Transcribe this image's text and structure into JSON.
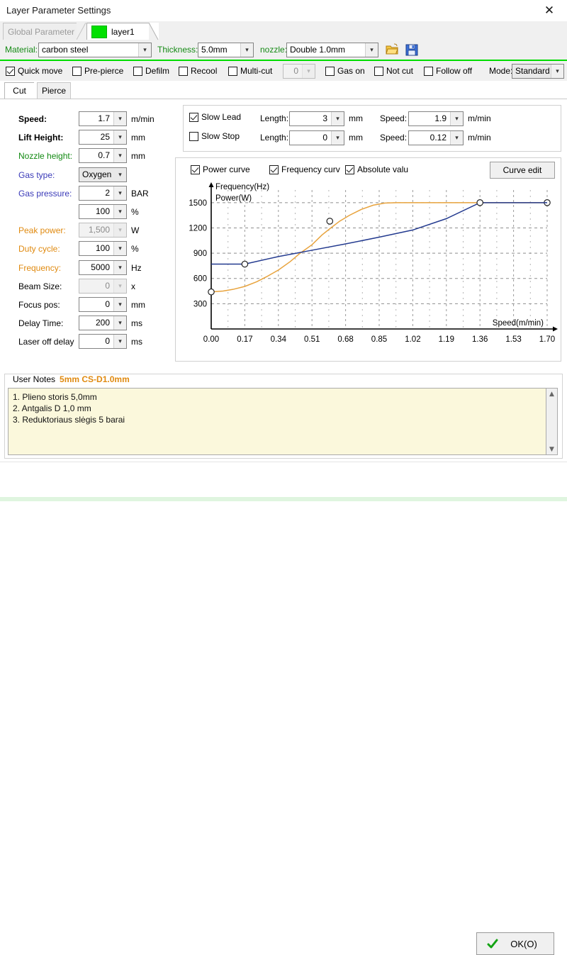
{
  "window": {
    "title": "Layer Parameter Settings",
    "close_label": "✕"
  },
  "tabs": [
    {
      "label": "Global Parameter",
      "active": false
    },
    {
      "label": "layer1",
      "active": true,
      "swatch_color": "#00e000"
    }
  ],
  "material_bar": {
    "material_label": "Material:",
    "material_value": "carbon steel",
    "thickness_label": "Thickness:",
    "thickness_value": "5.0mm",
    "nozzle_label": "nozzle:",
    "nozzle_value": "Double 1.0mm",
    "open_icon": "folder-open-icon",
    "save_icon": "save-disk-icon"
  },
  "option_row": {
    "quick_move": {
      "label": "Quick move",
      "checked": true
    },
    "pre_pierce": {
      "label": "Pre-pierce",
      "checked": false
    },
    "defilm": {
      "label": "Defilm",
      "checked": false
    },
    "recool": {
      "label": "Recool",
      "checked": false
    },
    "multi_cut": {
      "label": "Multi-cut",
      "checked": false
    },
    "multi_cut_count": "0",
    "gas_on": {
      "label": "Gas on",
      "checked": false
    },
    "not_cut": {
      "label": "Not cut",
      "checked": false
    },
    "follow_off": {
      "label": "Follow off",
      "checked": false
    },
    "mode_label": "Mode:",
    "mode_value": "Standard"
  },
  "sub_tabs": [
    {
      "label": "Cut",
      "active": true
    },
    {
      "label": "Pierce",
      "active": false
    }
  ],
  "parameters": [
    {
      "label": "Speed:",
      "value": "1.7",
      "unit": "m/min",
      "color": "#000000",
      "bold": true,
      "disabled": false
    },
    {
      "label": "Lift Height:",
      "value": "25",
      "unit": "mm",
      "color": "#000000",
      "bold": true,
      "disabled": false
    },
    {
      "label": "Nozzle height:",
      "value": "0.7",
      "unit": "mm",
      "color": "#128a12",
      "bold": false,
      "disabled": false
    },
    {
      "label": "Gas type:",
      "value": "Oxygen",
      "unit": "",
      "color": "#3a3ab8",
      "bold": false,
      "disabled": false,
      "combo": true
    },
    {
      "label": "Gas pressure:",
      "value": "2",
      "unit": "BAR",
      "color": "#3a3ab8",
      "bold": false,
      "disabled": false
    },
    {
      "label": "",
      "value": "100",
      "unit": "%",
      "color": "#000000",
      "bold": false,
      "disabled": false
    },
    {
      "label": "Peak power:",
      "value": "1,500",
      "unit": "W",
      "color": "#e08a10",
      "bold": false,
      "disabled": true
    },
    {
      "label": "Duty cycle:",
      "value": "100",
      "unit": "%",
      "color": "#e08a10",
      "bold": false,
      "disabled": false
    },
    {
      "label": "Frequency:",
      "value": "5000",
      "unit": "Hz",
      "color": "#e08a10",
      "bold": false,
      "disabled": false
    },
    {
      "label": "Beam Size:",
      "value": "0",
      "unit": "x",
      "color": "#000000",
      "bold": false,
      "disabled": true
    },
    {
      "label": "Focus pos:",
      "value": "0",
      "unit": "mm",
      "color": "#000000",
      "bold": false,
      "disabled": false
    },
    {
      "label": "Delay Time:",
      "value": "200",
      "unit": "ms",
      "color": "#000000",
      "bold": false,
      "disabled": false
    },
    {
      "label": "Laser off delay",
      "value": "0",
      "unit": "ms",
      "color": "#000000",
      "bold": false,
      "disabled": false
    }
  ],
  "slow_section": {
    "slow_lead": {
      "label": "Slow Lead",
      "checked": true
    },
    "slow_stop": {
      "label": "Slow Stop",
      "checked": false
    },
    "length_label": "Length:",
    "speed_label": "Speed:",
    "lead_length": "3",
    "lead_length_unit": "mm",
    "lead_speed": "1.9",
    "lead_speed_unit": "m/min",
    "stop_length": "0",
    "stop_length_unit": "mm",
    "stop_speed": "0.12",
    "stop_speed_unit": "m/min"
  },
  "curve_section": {
    "power_curve": {
      "label": "Power curve",
      "checked": true
    },
    "frequency_curve": {
      "label": "Frequency curv",
      "checked": true
    },
    "absolute_value": {
      "label": "Absolute valu",
      "checked": true
    },
    "curve_edit_label": "Curve edit"
  },
  "chart_data": {
    "type": "line",
    "title": "",
    "ylabel_top": "Frequency(Hz)",
    "ylabel_bottom": "Power(W)",
    "xlabel": "Speed(m/min)",
    "xlim": [
      0.0,
      1.7
    ],
    "ylim": [
      0,
      1650
    ],
    "xticks": [
      "0.00",
      "0.17",
      "0.34",
      "0.51",
      "0.68",
      "0.85",
      "1.02",
      "1.19",
      "1.36",
      "1.53",
      "1.70"
    ],
    "xtick_values": [
      0.0,
      0.17,
      0.34,
      0.51,
      0.68,
      0.85,
      1.02,
      1.19,
      1.36,
      1.53,
      1.7
    ],
    "yticks": [
      "300",
      "600",
      "900",
      "1200",
      "1500"
    ],
    "ytick_values": [
      300,
      600,
      900,
      1200,
      1500
    ],
    "grid": true,
    "legend": "none",
    "series": [
      {
        "name": "Frequency",
        "color": "#e8a33d",
        "markers": [
          [
            0.0,
            440
          ],
          [
            0.6,
            1280
          ],
          [
            1.7,
            1500
          ]
        ],
        "points": [
          [
            0.0,
            440
          ],
          [
            0.06,
            450
          ],
          [
            0.11,
            470
          ],
          [
            0.17,
            505
          ],
          [
            0.23,
            560
          ],
          [
            0.28,
            620
          ],
          [
            0.34,
            700
          ],
          [
            0.4,
            800
          ],
          [
            0.45,
            900
          ],
          [
            0.51,
            1000
          ],
          [
            0.56,
            1115
          ],
          [
            0.6,
            1190
          ],
          [
            0.65,
            1280
          ],
          [
            0.7,
            1350
          ],
          [
            0.76,
            1420
          ],
          [
            0.82,
            1470
          ],
          [
            0.88,
            1495
          ],
          [
            0.94,
            1500
          ],
          [
            1.0,
            1500
          ],
          [
            1.2,
            1500
          ],
          [
            1.45,
            1500
          ],
          [
            1.7,
            1500
          ]
        ]
      },
      {
        "name": "Power",
        "color": "#233a8f",
        "markers": [
          [
            0.17,
            770
          ],
          [
            1.36,
            1500
          ]
        ],
        "points": [
          [
            0.0,
            770
          ],
          [
            0.17,
            770
          ],
          [
            0.34,
            860
          ],
          [
            0.51,
            935
          ],
          [
            0.68,
            1010
          ],
          [
            0.85,
            1090
          ],
          [
            1.02,
            1175
          ],
          [
            1.19,
            1310
          ],
          [
            1.36,
            1500
          ],
          [
            1.7,
            1500
          ]
        ]
      }
    ]
  },
  "notes": {
    "legend_label": "User Notes",
    "legend_badge": "5mm CS-D1.0mm",
    "lines": [
      "1. Plieno storis 5,0mm",
      "2. Antgalis  D 1,0 mm",
      "3. Reduktoriaus slėgis 5 barai"
    ],
    "scroll_up": "▲",
    "scroll_down": "▼"
  },
  "footer": {
    "ok_label": "OK(O)",
    "ok_icon": "green-check-icon"
  }
}
